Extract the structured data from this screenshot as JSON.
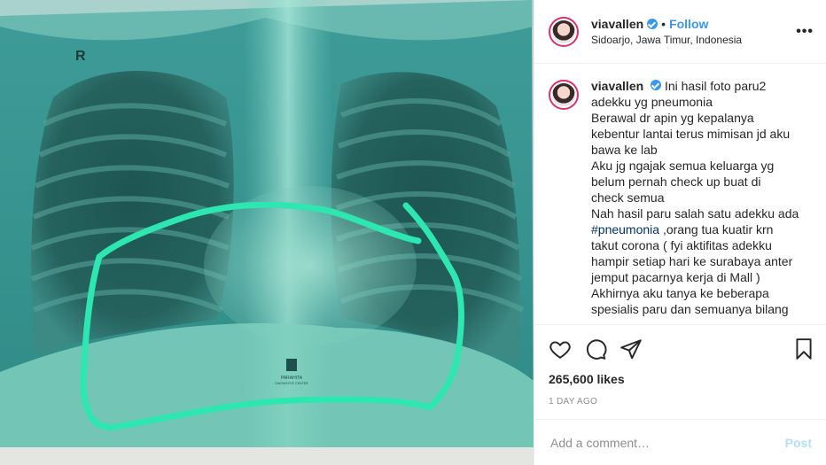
{
  "colors": {
    "accent": "#3897f0",
    "highlight_stroke": "#2ee6b0",
    "xray_tint": "#3fa3a0"
  },
  "media": {
    "marker_letter": "R",
    "clinic_logo_text": "PARAHITA",
    "clinic_logo_sub": "DIAGNOSTIC CENTER"
  },
  "header": {
    "username": "viavallen",
    "separator": "•",
    "follow_label": "Follow",
    "location": "Sidoarjo, Jawa Timur, Indonesia",
    "more_icon": "ellipsis-icon",
    "more_label": "•••"
  },
  "caption": {
    "username": "viavallen",
    "lines": [
      "Ini hasil foto paru2",
      "adekku yg pneumonia",
      "Berawal dr apin yg kepalanya",
      "kebentur lantai terus mimisan jd aku",
      "bawa ke lab",
      "Aku jg ngajak semua keluarga yg",
      "belum pernah check up buat di",
      "check semua",
      "Nah hasil paru salah satu adekku ada"
    ],
    "hashtag": "#pneumonia",
    "after_hashtag": " ,orang tua kuatir krn",
    "lines_after": [
      "takut corona ( fyi aktifitas adekku",
      "hampir setiap hari ke surabaya anter",
      "jemput pacarnya kerja di Mall )",
      "Akhirnya aku tanya ke beberapa",
      "spesialis paru dan semuanya bilang"
    ]
  },
  "actions": {
    "like_icon": "heart-icon",
    "comment_icon": "comment-icon",
    "share_icon": "share-icon",
    "save_icon": "bookmark-icon"
  },
  "stats": {
    "likes": "265,600 likes",
    "time": "1 DAY AGO"
  },
  "comment_box": {
    "placeholder": "Add a comment…",
    "post_label": "Post"
  }
}
